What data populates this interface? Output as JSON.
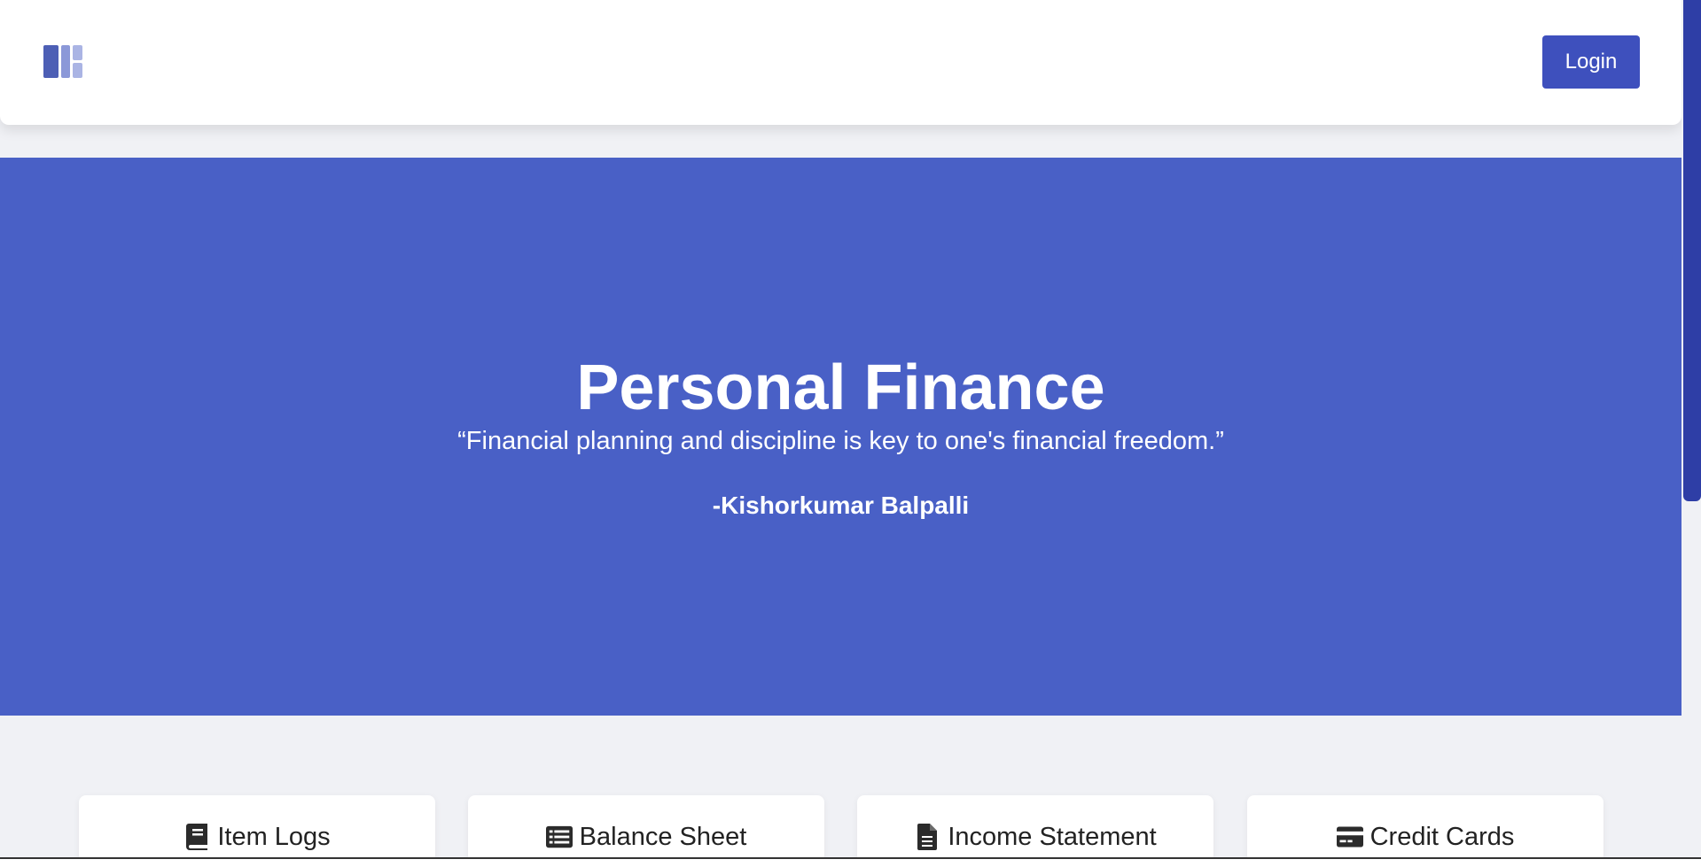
{
  "navbar": {
    "logo_icon": "dashboard-logo-icon",
    "login_label": "Login"
  },
  "hero": {
    "title": "Personal Finance",
    "quote": "“Financial planning and discipline is key to one's financial freedom.”",
    "author": "-Kishorkumar Balpalli"
  },
  "cards": [
    {
      "label": "Item Logs",
      "icon": "book-icon"
    },
    {
      "label": "Balance Sheet",
      "icon": "list-icon"
    },
    {
      "label": "Income Statement",
      "icon": "file-icon"
    },
    {
      "label": "Credit Cards",
      "icon": "credit-card-icon"
    }
  ],
  "colors": {
    "accent": "#3e50bd",
    "hero_background": "#4960c6",
    "page_background": "#f0f1f5",
    "scrollbar_thumb": "#2e3ea6"
  }
}
